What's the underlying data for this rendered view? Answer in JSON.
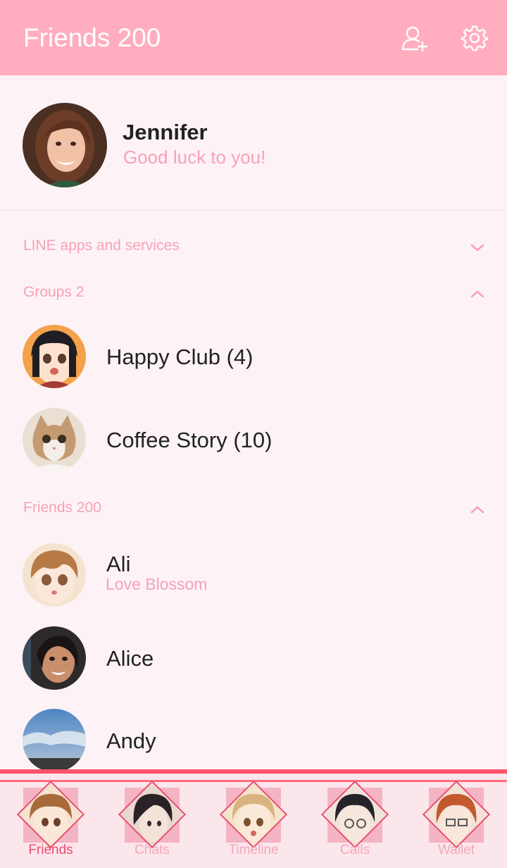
{
  "header": {
    "title": "Friends 200",
    "add_icon": "add-friend-icon",
    "settings_icon": "gear-icon"
  },
  "profile": {
    "name": "Jennifer",
    "status": "Good luck to you!"
  },
  "sections": {
    "apps": {
      "label": "LINE apps and services",
      "state": "collapsed"
    },
    "groups": {
      "label": "Groups 2",
      "state": "expanded"
    },
    "friends": {
      "label": "Friends 200",
      "state": "expanded"
    }
  },
  "groups": [
    {
      "name": "Happy Club (4)"
    },
    {
      "name": "Coffee Story (10)"
    }
  ],
  "friends": [
    {
      "name": "Ali",
      "status": "Love Blossom"
    },
    {
      "name": "Alice",
      "status": ""
    },
    {
      "name": "Andy",
      "status": ""
    }
  ],
  "tabs": [
    {
      "label": "Friends",
      "active": true
    },
    {
      "label": "Chats",
      "active": false
    },
    {
      "label": "Timeline",
      "active": false
    },
    {
      "label": "Calls",
      "active": false
    },
    {
      "label": "Wallet",
      "active": false
    }
  ],
  "colors": {
    "header": "#ffadbf",
    "accent": "#f7a1b7",
    "active_tab": "#f04c6e",
    "tab_line": "#ff5368"
  }
}
